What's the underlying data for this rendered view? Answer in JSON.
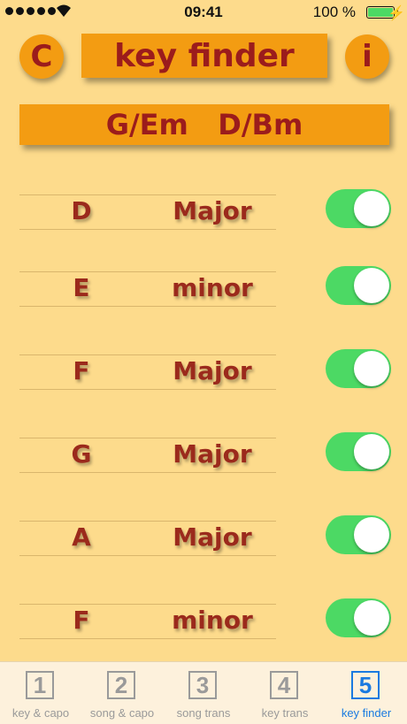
{
  "status_bar": {
    "time": "09:41",
    "battery_text": "100 %"
  },
  "header": {
    "left_button": "C",
    "title": "key finder",
    "info_button": "i"
  },
  "result": "G/Em   D/Bm",
  "rows": [
    {
      "note": "D",
      "quality": "Major",
      "on": true
    },
    {
      "note": "E",
      "quality": "minor",
      "on": true
    },
    {
      "note": "F",
      "quality": "Major",
      "on": true
    },
    {
      "note": "G",
      "quality": "Major",
      "on": true
    },
    {
      "note": "A",
      "quality": "Major",
      "on": true
    },
    {
      "note": "F",
      "quality": "minor",
      "on": true
    }
  ],
  "tabs": [
    {
      "num": "1",
      "label": "key & capo"
    },
    {
      "num": "2",
      "label": "song & capo"
    },
    {
      "num": "3",
      "label": "song trans"
    },
    {
      "num": "4",
      "label": "key trans"
    },
    {
      "num": "5",
      "label": "key finder"
    }
  ],
  "colors": {
    "accent": "#f39c12",
    "text": "#9b1c1c",
    "toggle_on": "#4cd964",
    "tab_active": "#1a7ae0"
  }
}
